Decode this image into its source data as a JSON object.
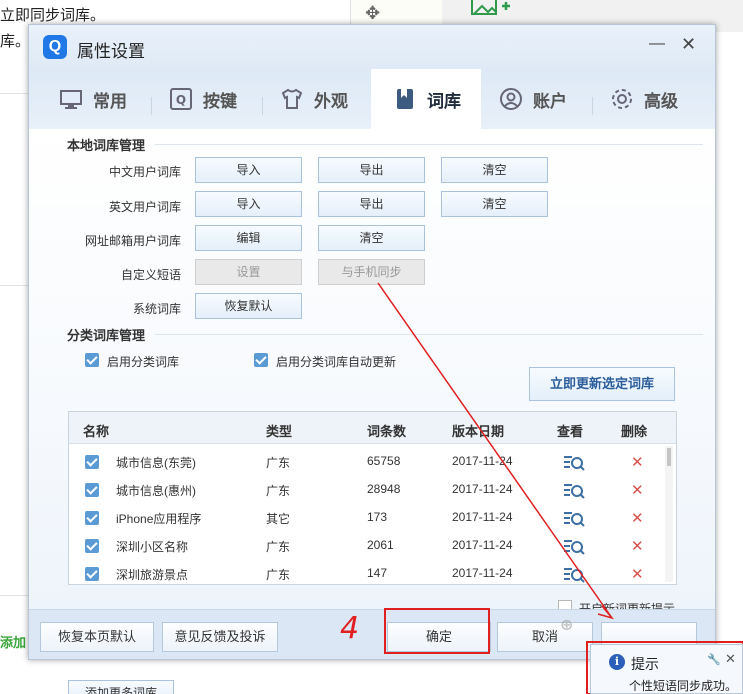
{
  "background": {
    "doc_text_line1": "立即同步词库。",
    "doc_text_line2": "库。",
    "bottom_left_text": "添加"
  },
  "dialog": {
    "title": "属性设置",
    "logo_letter": "Q",
    "min_icon": "—",
    "close_icon": "✕",
    "tabs": [
      {
        "label": "常用",
        "icon": "monitor-icon"
      },
      {
        "label": "按键",
        "icon": "key-icon"
      },
      {
        "label": "外观",
        "icon": "shirt-icon"
      },
      {
        "label": "词库",
        "icon": "book-icon",
        "active": true
      },
      {
        "label": "账户",
        "icon": "user-icon"
      },
      {
        "label": "高级",
        "icon": "gear-icon"
      }
    ]
  },
  "local": {
    "title": "本地词库管理",
    "rows": {
      "cn": {
        "label": "中文用户词库",
        "import": "导入",
        "export": "导出",
        "clear": "清空"
      },
      "en": {
        "label": "英文用户词库",
        "import": "导入",
        "export": "导出",
        "clear": "清空"
      },
      "url": {
        "label": "网址邮箱用户词库",
        "edit": "编辑",
        "clear": "清空"
      },
      "custom": {
        "label": "自定义短语",
        "settings": "设置",
        "sync": "与手机同步"
      },
      "system": {
        "label": "系统词库",
        "restore": "恢复默认"
      }
    }
  },
  "category": {
    "title": "分类词库管理",
    "enable_label": "启用分类词库",
    "auto_update_label": "启用分类词库自动更新",
    "update_now": "立即更新选定词库",
    "table": {
      "headers": [
        "名称",
        "类型",
        "词条数",
        "版本日期",
        "查看",
        "删除"
      ],
      "rows": [
        {
          "name": "城市信息(东莞)",
          "type": "广东",
          "count": "65758",
          "date": "2017-11-24"
        },
        {
          "name": "城市信息(惠州)",
          "type": "广东",
          "count": "28948",
          "date": "2017-11-24"
        },
        {
          "name": "iPhone应用程序",
          "type": "其它",
          "count": "173",
          "date": "2017-11-24"
        },
        {
          "name": "深圳小区名称",
          "type": "广东",
          "count": "2061",
          "date": "2017-11-24"
        },
        {
          "name": "深圳旅游景点",
          "type": "广东",
          "count": "147",
          "date": "2017-11-24"
        }
      ]
    },
    "add_more": "添加更多词库",
    "new_word_hint": "开启新词更新提示"
  },
  "footer": {
    "restore_page": "恢复本页默认",
    "feedback": "意见反馈及投诉",
    "ok": "确定",
    "cancel": "取消"
  },
  "annotation": {
    "step_number": "4",
    "color": "#e02020"
  },
  "toast": {
    "info_letter": "i",
    "title": "提示",
    "message": "个性短语同步成功。",
    "pin_icon": "🔧",
    "close_icon": "✕"
  },
  "colors": {
    "accent": "#1f78e6",
    "check": "#5b9bd5",
    "delete": "#d9534f",
    "link_text": "#2a5d9a"
  }
}
